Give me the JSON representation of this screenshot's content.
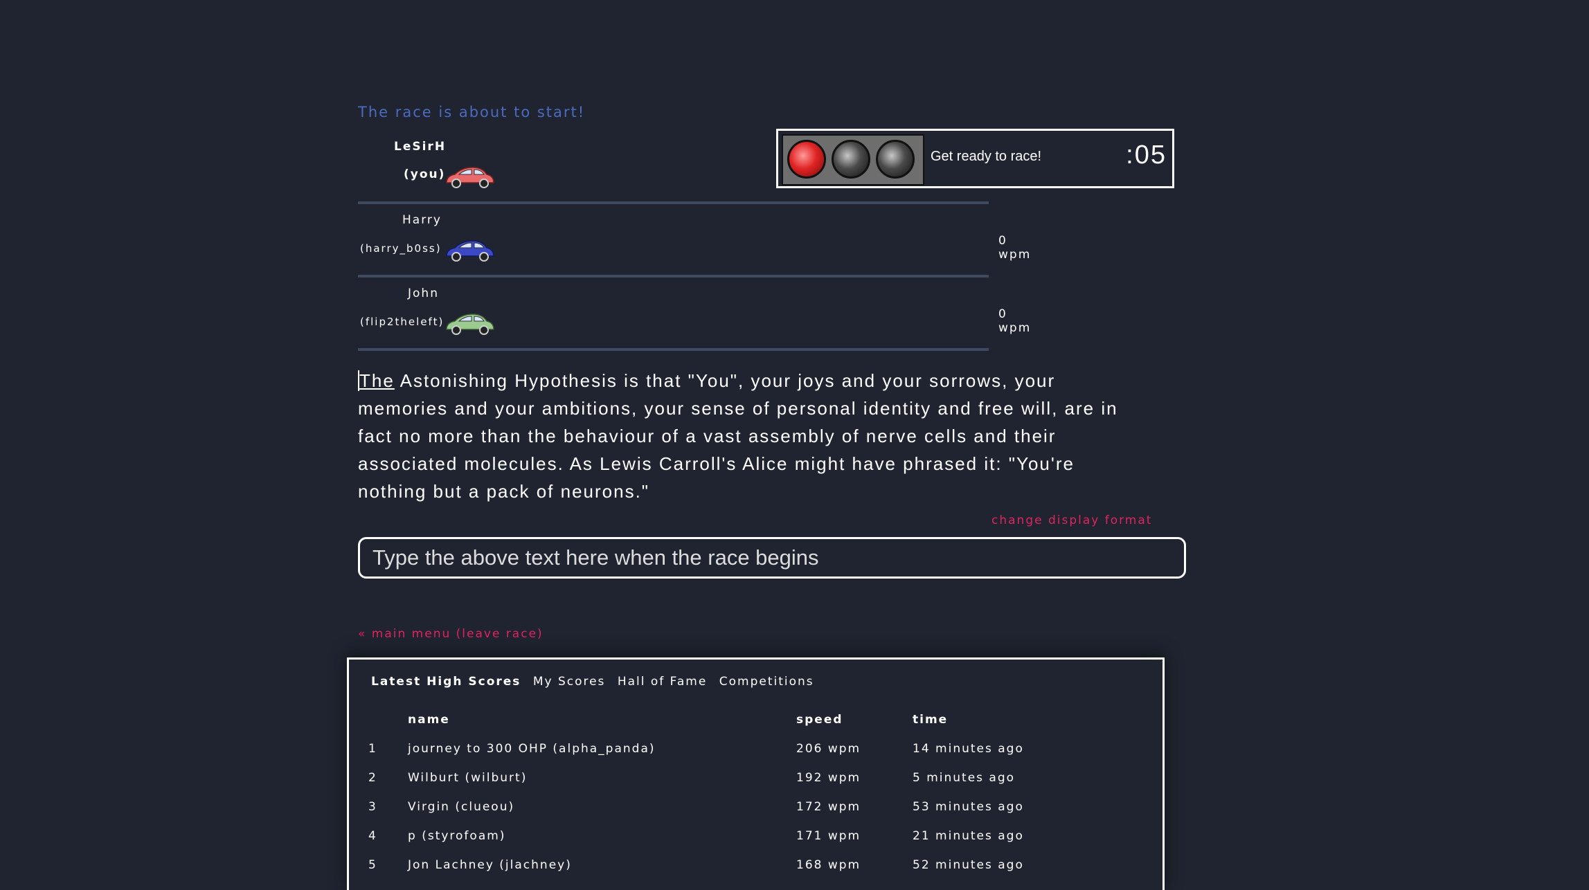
{
  "status": "The race is about to start!",
  "racers": [
    {
      "name": "LeSirH",
      "handle": "(you)",
      "wpm": "",
      "car_color": "#e86a6a"
    },
    {
      "name": "Harry",
      "handle": "(harry_b0ss)",
      "wpm": "0 wpm",
      "car_color": "#3b49c4"
    },
    {
      "name": "John",
      "handle": "(flip2theleft)",
      "wpm": "0 wpm",
      "car_color": "#9ccb8f"
    }
  ],
  "light": {
    "message": "Get ready to race!",
    "countdown": ":05",
    "bulbs": [
      "red",
      "off",
      "off"
    ]
  },
  "passage": {
    "current_word": "The",
    "rest": " Astonishing Hypothesis is that \"You\", your joys and your sorrows, your memories and your ambitions, your sense of personal identity and free will, are in fact no more than the behaviour of a vast assembly of nerve cells and their associated molecules. As Lewis Carroll's Alice might have phrased it: \"You're nothing but a pack of neurons.\""
  },
  "change_format_label": "change display format",
  "input": {
    "placeholder": "Type the above text here when the race begins",
    "value": ""
  },
  "main_menu_label": "« main menu (leave race)",
  "scores": {
    "tabs": [
      "Latest High Scores",
      "My Scores",
      "Hall of Fame",
      "Competitions"
    ],
    "active_tab": 0,
    "headers": {
      "name": "name",
      "speed": "speed",
      "time": "time"
    },
    "rows": [
      {
        "rank": "1",
        "name": "journey to 300 OHP (alpha_panda)",
        "speed": "206 wpm",
        "time": "14 minutes ago"
      },
      {
        "rank": "2",
        "name": "Wilburt (wilburt)",
        "speed": "192 wpm",
        "time": "5 minutes ago"
      },
      {
        "rank": "3",
        "name": "Virgin (clueou)",
        "speed": "172 wpm",
        "time": "53 minutes ago"
      },
      {
        "rank": "4",
        "name": "p (styrofoam)",
        "speed": "171 wpm",
        "time": "21 minutes ago"
      },
      {
        "rank": "5",
        "name": "Jon Lachney (jlachney)",
        "speed": "168 wpm",
        "time": "52 minutes ago"
      }
    ]
  }
}
